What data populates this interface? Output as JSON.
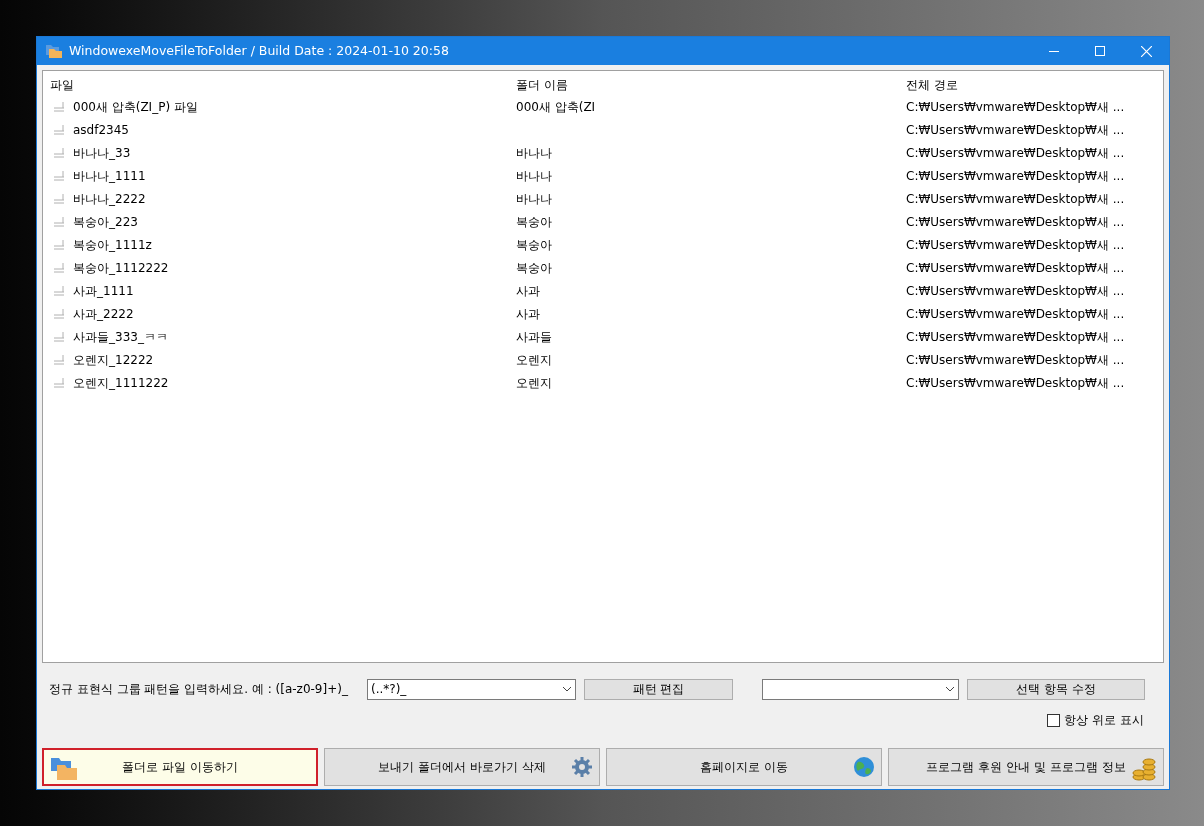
{
  "window": {
    "title": "WindowexeMoveFileToFolder / Build Date : 2024-01-10 20:58"
  },
  "table": {
    "columns": [
      "파일",
      "폴더 이름",
      "전체 경로"
    ],
    "rows": [
      {
        "file": "000새 압축(ZI_P) 파일",
        "folder": "000새 압축(ZI",
        "path": "C:₩Users₩vmware₩Desktop₩새 ..."
      },
      {
        "file": "asdf2345",
        "folder": "",
        "path": "C:₩Users₩vmware₩Desktop₩새 ..."
      },
      {
        "file": "바나나_33",
        "folder": "바나나",
        "path": "C:₩Users₩vmware₩Desktop₩새 ..."
      },
      {
        "file": "바나나_1111",
        "folder": "바나나",
        "path": "C:₩Users₩vmware₩Desktop₩새 ..."
      },
      {
        "file": "바나나_2222",
        "folder": "바나나",
        "path": "C:₩Users₩vmware₩Desktop₩새 ..."
      },
      {
        "file": "복숭아_223",
        "folder": "복숭아",
        "path": "C:₩Users₩vmware₩Desktop₩새 ..."
      },
      {
        "file": "복숭아_1111z",
        "folder": "복숭아",
        "path": "C:₩Users₩vmware₩Desktop₩새 ..."
      },
      {
        "file": "복숭아_1112222",
        "folder": "복숭아",
        "path": "C:₩Users₩vmware₩Desktop₩새 ..."
      },
      {
        "file": "사과_1111",
        "folder": "사과",
        "path": "C:₩Users₩vmware₩Desktop₩새 ..."
      },
      {
        "file": "사과_2222",
        "folder": "사과",
        "path": "C:₩Users₩vmware₩Desktop₩새 ..."
      },
      {
        "file": "사과들_333_ㅋㅋ",
        "folder": "사과들",
        "path": "C:₩Users₩vmware₩Desktop₩새 ..."
      },
      {
        "file": "오렌지_12222",
        "folder": "오렌지",
        "path": "C:₩Users₩vmware₩Desktop₩새 ..."
      },
      {
        "file": "오렌지_1111222",
        "folder": "오렌지",
        "path": "C:₩Users₩vmware₩Desktop₩새 ..."
      }
    ]
  },
  "pattern": {
    "label": "정규 표현식 그룹 패턴을 입력하세요. 예 : ([a-z0-9]+)_",
    "value": "(..*?)_",
    "edit_button": "패턴 편집"
  },
  "selection": {
    "button": "선택 항목 수정"
  },
  "always_on_top": {
    "label": "항상 위로 표시",
    "checked": false
  },
  "buttons": [
    {
      "label": "폴더로 파일 이동하기",
      "focused": true
    },
    {
      "label": "보내기 폴더에서 바로가기 삭제",
      "focused": false
    },
    {
      "label": "홈페이지로 이동",
      "focused": false
    },
    {
      "label": "프로그램 후원 안내 및 프로그램 정보",
      "focused": false
    }
  ]
}
